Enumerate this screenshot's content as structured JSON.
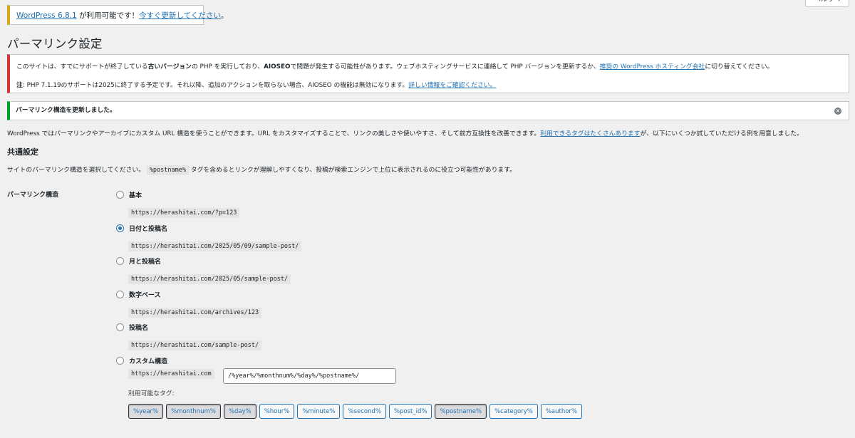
{
  "help_tab": "ヘルプ ▾",
  "update_nag": {
    "version_link": "WordPress 6.8.1",
    "text": " が利用可能です！",
    "update_link": "今すぐ更新してください",
    "end": "。"
  },
  "page_title": "パーマリンク設定",
  "php_notice": {
    "line1_a": "このサイトは、すでにサポートが終了している",
    "line1_bold": "古いバージョン",
    "line1_b": "の PHP を実行しており、",
    "line1_bold2": "AIOSEO",
    "line1_c": "で問題が発生する可能性があります。ウェブホスティングサービスに連絡して PHP バージョンを更新するか、",
    "line1_link": "推奨の WordPress ホスティング会社",
    "line1_d": "に切り替えてください。",
    "line2_bold": "注",
    "line2_a": ": PHP 7.1.19のサポートは2025に終了する予定です。それ以降、追加のアクションを取らない場合、AIOSEO の機能は無効になります。",
    "line2_link": "詳しい情報をご確認ください。"
  },
  "success_notice": "パーマリンク構造を更新しました。",
  "dismiss_icon": "×",
  "intro": {
    "text": "WordPress ではパーマリンクやアーカイブにカスタム URL 構造を使うことができます。URL をカスタマイズすることで、リンクの美しさや使いやすさ、そして前方互換性を改善できます。",
    "link": "利用できるタグはたくさんあります",
    "end": "が、以下にいくつか試していただける例を用意しました。"
  },
  "common_settings": {
    "heading": "共通設定",
    "desc_a": "サイトのパーマリンク構造を選択してください。",
    "desc_code": "%postname%",
    "desc_b": " タグを含めるとリンクが理解しやすくなり、投稿が検索エンジンで上位に表示されるのに役立つ可能性があります。"
  },
  "permalink_label": "パーマリンク構造",
  "options": [
    {
      "label": "基本",
      "sample": "https://herashitai.com/?p=123",
      "checked": false
    },
    {
      "label": "日付と投稿名",
      "sample": "https://herashitai.com/2025/05/09/sample-post/",
      "checked": true
    },
    {
      "label": "月と投稿名",
      "sample": "https://herashitai.com/2025/05/sample-post/",
      "checked": false
    },
    {
      "label": "数字ベース",
      "sample": "https://herashitai.com/archives/123",
      "checked": false
    },
    {
      "label": "投稿名",
      "sample": "https://herashitai.com/sample-post/",
      "checked": false
    },
    {
      "label": "カスタム構造",
      "checked": false
    }
  ],
  "custom": {
    "prefix": "https://herashitai.com",
    "value": "/%year%/%monthnum%/%day%/%postname%/"
  },
  "available_tags_label": "利用可能なタグ:",
  "tags": [
    {
      "label": "%year%",
      "active": true
    },
    {
      "label": "%monthnum%",
      "active": true
    },
    {
      "label": "%day%",
      "active": true
    },
    {
      "label": "%hour%",
      "active": false
    },
    {
      "label": "%minute%",
      "active": false
    },
    {
      "label": "%second%",
      "active": false
    },
    {
      "label": "%post_id%",
      "active": false
    },
    {
      "label": "%postname%",
      "active": true
    },
    {
      "label": "%category%",
      "active": false
    },
    {
      "label": "%author%",
      "active": false
    }
  ],
  "colors": {
    "link": "#2271b1",
    "error_border": "#d63638",
    "success_border": "#00a32a",
    "warning_border": "#dba617",
    "background": "#f0f0f1"
  }
}
